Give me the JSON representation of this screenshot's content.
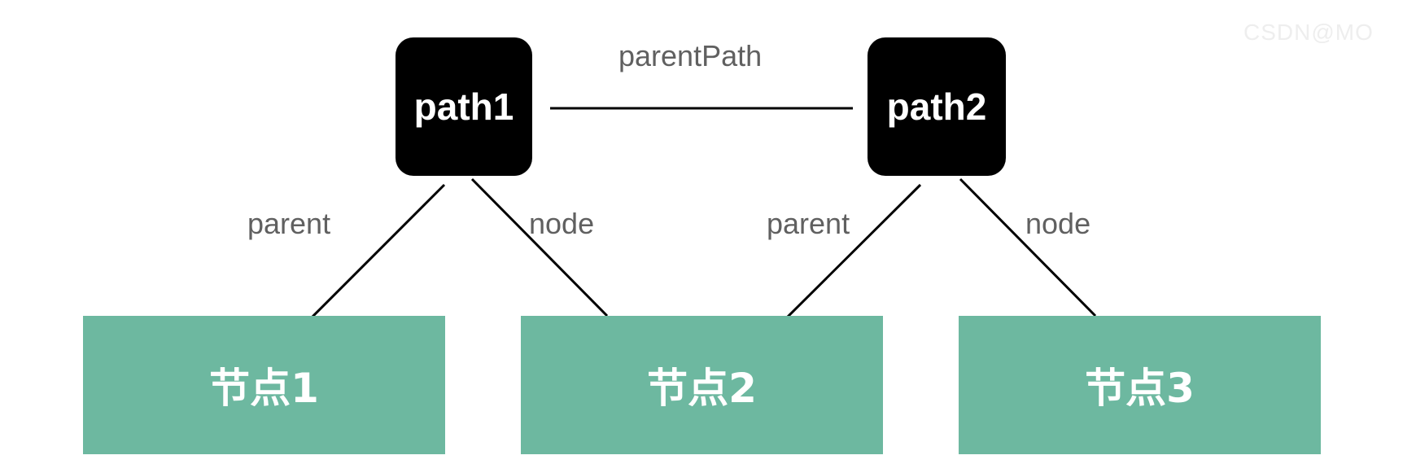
{
  "paths": [
    {
      "label": "path1"
    },
    {
      "label": "path2"
    }
  ],
  "nodes": [
    {
      "label": "节点1"
    },
    {
      "label": "节点2"
    },
    {
      "label": "节点3"
    }
  ],
  "edges": {
    "parent_path": "parentPath",
    "path1_parent": "parent",
    "path1_node": "node",
    "path2_parent": "parent",
    "path2_node": "node"
  },
  "watermark": "CSDN@MO",
  "colors": {
    "path_box": "#000000",
    "node_box": "#6db8a0",
    "edge_line": "#000000",
    "edge_label": "#606060"
  }
}
